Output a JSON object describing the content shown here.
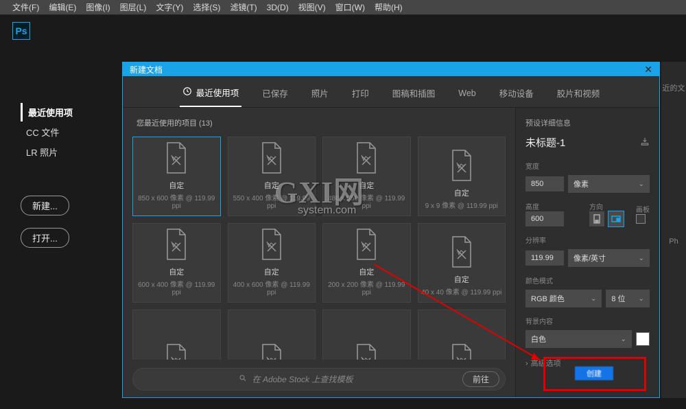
{
  "menubar": [
    "文件(F)",
    "编辑(E)",
    "图像(I)",
    "图层(L)",
    "文字(Y)",
    "选择(S)",
    "滤镜(T)",
    "3D(D)",
    "视图(V)",
    "窗口(W)",
    "帮助(H)"
  ],
  "logo": "Ps",
  "leftPanel": {
    "items": [
      {
        "label": "最近使用项",
        "active": true
      },
      {
        "label": "CC 文件",
        "active": false
      },
      {
        "label": "LR 照片",
        "active": false
      }
    ],
    "buttons": [
      "新建...",
      "打开..."
    ]
  },
  "dialog": {
    "title": "新建文档",
    "tabs": [
      {
        "label": "最近使用项",
        "active": true,
        "icon": "clock"
      },
      {
        "label": "已保存",
        "active": false
      },
      {
        "label": "照片",
        "active": false
      },
      {
        "label": "打印",
        "active": false
      },
      {
        "label": "图稿和插图",
        "active": false
      },
      {
        "label": "Web",
        "active": false
      },
      {
        "label": "移动设备",
        "active": false
      },
      {
        "label": "胶片和视频",
        "active": false
      }
    ],
    "presetsHeading": "您最近使用的项目  (13)",
    "presets": [
      {
        "label": "自定",
        "dim": "850 x 600 像素 @ 119.99 ppi",
        "selected": true
      },
      {
        "label": "自定",
        "dim": "550 x 400 像素 @ 119.99 ppi"
      },
      {
        "label": "自定",
        "dim": "480 x 550 像素 @ 119.99 ppi"
      },
      {
        "label": "自定",
        "dim": "9 x 9 像素 @ 119.99 ppi"
      },
      {
        "label": "自定",
        "dim": "600 x 400 像素 @ 119.99 ppi"
      },
      {
        "label": "自定",
        "dim": "400 x 600 像素 @ 119.99 ppi"
      },
      {
        "label": "自定",
        "dim": "200 x 200 像素 @ 119.99 ppi"
      },
      {
        "label": "自定",
        "dim": "40 x 40 像素 @ 119.99 ppi"
      },
      {
        "label": "",
        "dim": ""
      },
      {
        "label": "",
        "dim": ""
      },
      {
        "label": "",
        "dim": ""
      },
      {
        "label": "",
        "dim": ""
      }
    ],
    "stock": {
      "placeholder": "在 Adobe Stock 上查找模板",
      "go": "前往"
    },
    "details": {
      "heading": "预设详细信息",
      "docName": "未标题-1",
      "widthLabel": "宽度",
      "width": "850",
      "widthUnit": "像素",
      "heightLabel": "高度",
      "height": "600",
      "orientLabel": "方向",
      "artboardLabel": "画板",
      "resLabel": "分辨率",
      "res": "119.99",
      "resUnit": "像素/英寸",
      "colorLabel": "颜色模式",
      "colorMode": "RGB 颜色",
      "bits": "8 位",
      "bgLabel": "背景内容",
      "bg": "白色",
      "adv": "高级选项"
    },
    "createButton": "创建"
  },
  "rightStrip": {
    "top": "近的文",
    "bottom": "Ph"
  },
  "watermark": {
    "main": "GXI网",
    "sub": "system.com"
  }
}
